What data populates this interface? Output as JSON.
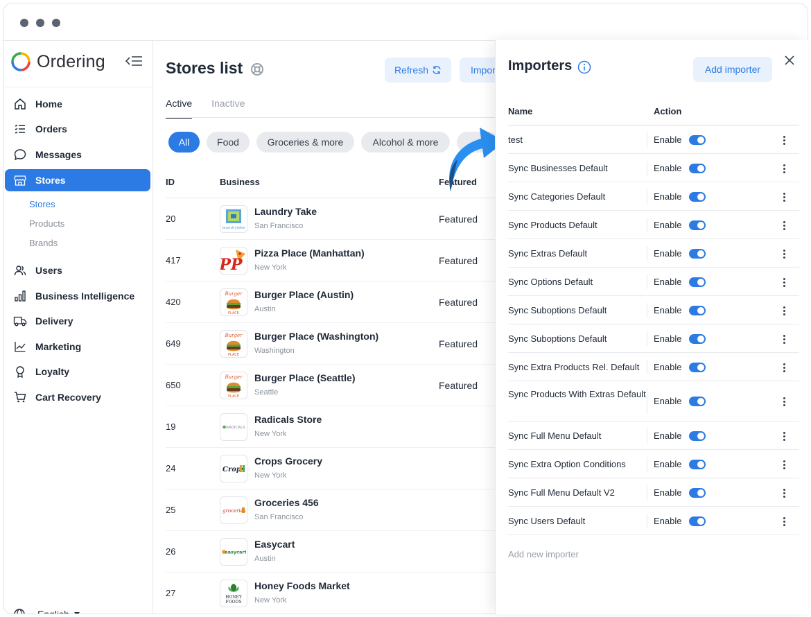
{
  "colors": {
    "accent": "#2c7be5",
    "chip_bg": "#e8eaed",
    "light_btn_bg": "#e9f1fd",
    "window_dots": "#5b6474"
  },
  "brand": {
    "name": "Ordering"
  },
  "sidebar": {
    "items": [
      {
        "label": "Home",
        "icon": "home-icon"
      },
      {
        "label": "Orders",
        "icon": "list-icon"
      },
      {
        "label": "Messages",
        "icon": "chat-icon"
      },
      {
        "label": "Stores",
        "icon": "store-icon"
      },
      {
        "label": "Users",
        "icon": "users-icon"
      },
      {
        "label": "Business Intelligence",
        "icon": "bar-chart-icon"
      },
      {
        "label": "Delivery",
        "icon": "truck-icon"
      },
      {
        "label": "Marketing",
        "icon": "line-chart-icon"
      },
      {
        "label": "Loyalty",
        "icon": "award-icon"
      },
      {
        "label": "Cart Recovery",
        "icon": "cart-icon"
      }
    ],
    "sub_items": [
      "Stores",
      "Products",
      "Brands"
    ],
    "language": "English"
  },
  "main": {
    "title": "Stores list",
    "refresh_label": "Refresh",
    "import_label": "Impor",
    "tabs": [
      "Active",
      "Inactive"
    ],
    "chips": [
      "All",
      "Food",
      "Groceries & more",
      "Alcohol & more"
    ],
    "columns": {
      "id": "ID",
      "business": "Business",
      "featured": "Featured"
    },
    "rows": [
      {
        "id": "20",
        "name": "Laundry Take",
        "city": "San Francisco",
        "featured": "Featured"
      },
      {
        "id": "417",
        "name": "Pizza Place (Manhattan)",
        "city": "New York",
        "featured": "Featured"
      },
      {
        "id": "420",
        "name": "Burger Place (Austin)",
        "city": "Austin",
        "featured": "Featured"
      },
      {
        "id": "649",
        "name": "Burger Place (Washington)",
        "city": "Washington",
        "featured": "Featured"
      },
      {
        "id": "650",
        "name": "Burger Place (Seattle)",
        "city": "Seattle",
        "featured": "Featured"
      },
      {
        "id": "19",
        "name": "Radicals Store",
        "city": "New York",
        "featured": ""
      },
      {
        "id": "24",
        "name": "Crops Grocery",
        "city": "New York",
        "featured": ""
      },
      {
        "id": "25",
        "name": "Groceries 456",
        "city": "San Francisco",
        "featured": ""
      },
      {
        "id": "26",
        "name": "Easycart",
        "city": "Austin",
        "featured": ""
      },
      {
        "id": "27",
        "name": "Honey Foods Market",
        "city": "New York",
        "featured": ""
      }
    ],
    "logo_text": {
      "laundry": "laundrytake",
      "pizza": "PP",
      "burger_top": "Burger",
      "burger_bottom": "PLACE",
      "radicals": "RADICALS",
      "crops": "Crops",
      "groceries": "groceries",
      "easycart": "easycart",
      "honey_top": "HONEY",
      "honey_bottom": "FOODS"
    }
  },
  "importers": {
    "title": "Importers",
    "add_label": "Add importer",
    "columns": {
      "name": "Name",
      "action": "Action"
    },
    "rows": [
      {
        "name": "test",
        "action": "Enable"
      },
      {
        "name": "Sync Businesses Default",
        "action": "Enable"
      },
      {
        "name": "Sync Categories Default",
        "action": "Enable"
      },
      {
        "name": "Sync Products Default",
        "action": "Enable"
      },
      {
        "name": "Sync Extras Default",
        "action": "Enable"
      },
      {
        "name": "Sync Options Default",
        "action": "Enable"
      },
      {
        "name": "Sync Suboptions Default",
        "action": "Enable"
      },
      {
        "name": "Sync Suboptions Default",
        "action": "Enable"
      },
      {
        "name": "Sync Extra Products Rel. Default",
        "action": "Enable"
      },
      {
        "name": "Sync Products With Extras Default",
        "action": "Enable"
      },
      {
        "name": "Sync Full Menu Default",
        "action": "Enable"
      },
      {
        "name": "Sync Extra Option Conditions",
        "action": "Enable"
      },
      {
        "name": "Sync Full Menu Default V2",
        "action": "Enable"
      },
      {
        "name": "Sync Users Default",
        "action": "Enable"
      }
    ],
    "add_new_label": "Add new importer"
  }
}
